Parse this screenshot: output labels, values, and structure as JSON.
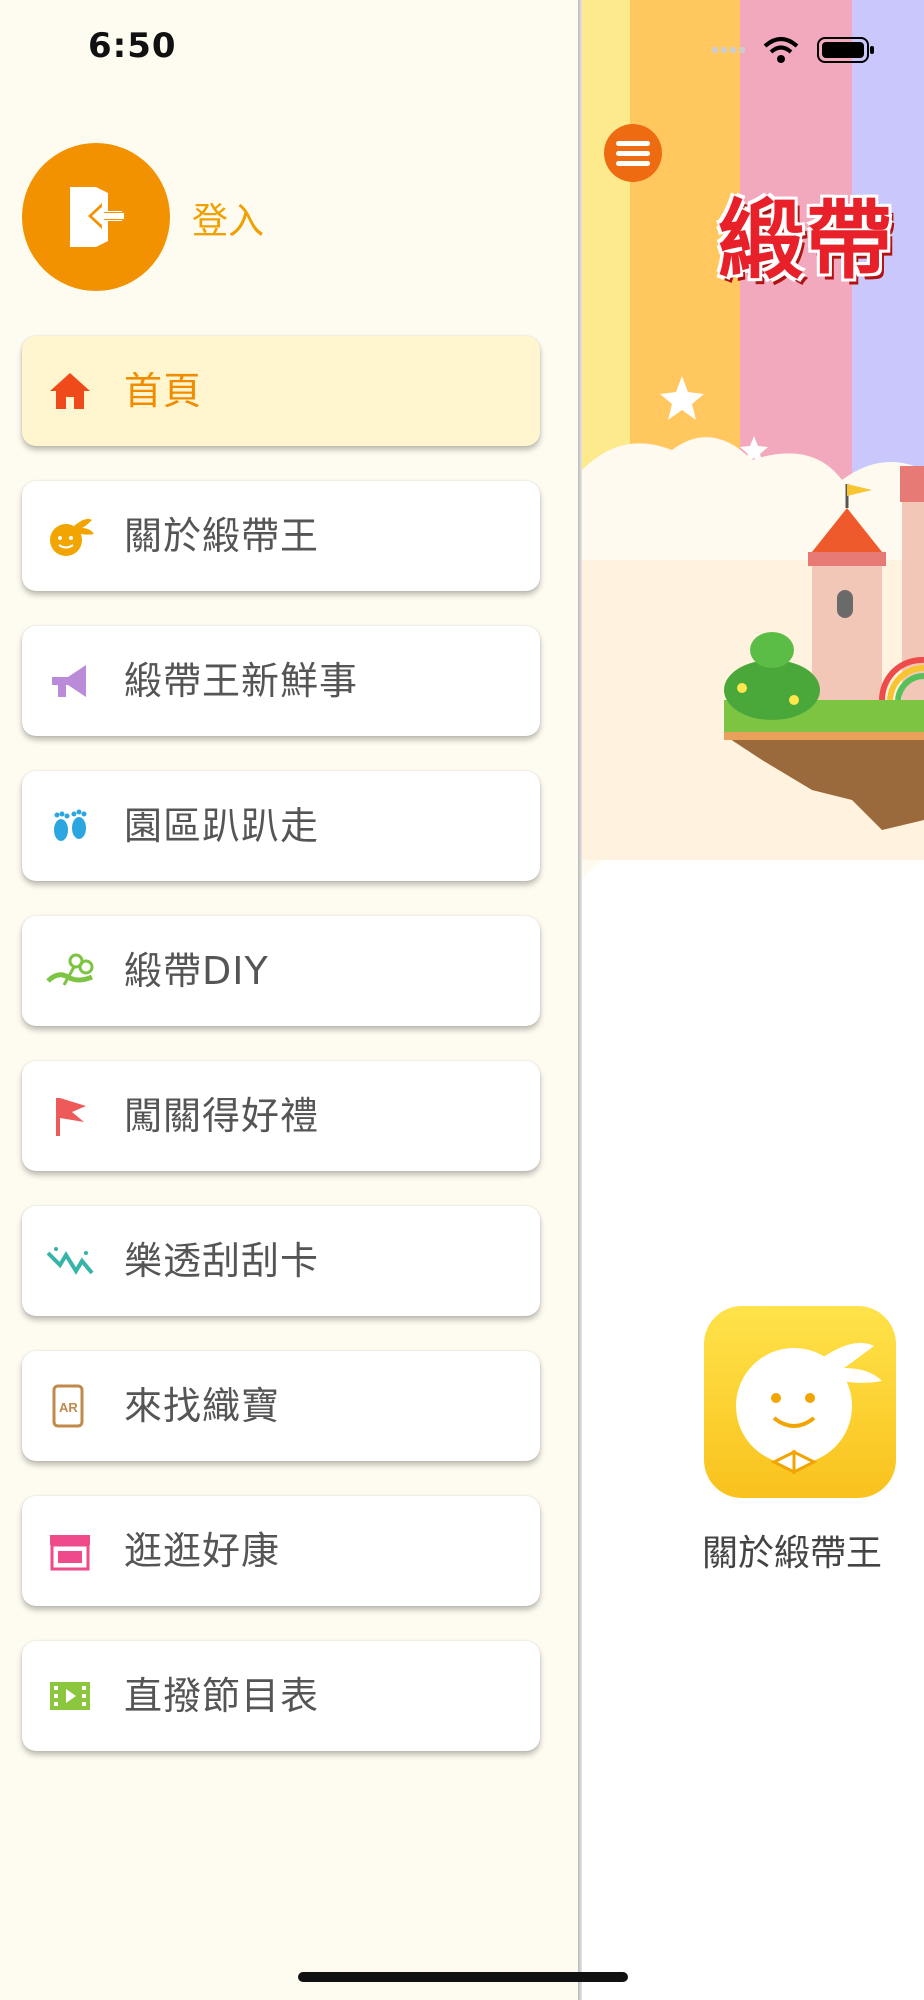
{
  "status_bar": {
    "time": "6:50"
  },
  "drawer": {
    "login_label": "登入",
    "menu": [
      {
        "label": "首頁",
        "icon": "home-icon",
        "active": true
      },
      {
        "label": "關於緞帶王",
        "icon": "mascot-icon",
        "active": false
      },
      {
        "label": "緞帶王新鮮事",
        "icon": "megaphone-icon",
        "active": false
      },
      {
        "label": "園區趴趴走",
        "icon": "footprints-icon",
        "active": false
      },
      {
        "label": "緞帶DIY",
        "icon": "ribbon-scissors-icon",
        "active": false
      },
      {
        "label": "闖關得好禮",
        "icon": "flag-icon",
        "active": false
      },
      {
        "label": "樂透刮刮卡",
        "icon": "scratch-card-icon",
        "active": false
      },
      {
        "label": "來找織寶",
        "icon": "ar-phone-icon",
        "active": false
      },
      {
        "label": "逛逛好康",
        "icon": "shop-icon",
        "active": false
      },
      {
        "label": "直撥節目表",
        "icon": "video-icon",
        "active": false
      }
    ]
  },
  "main": {
    "brand_title": "緞帶",
    "about_tile_label": "關於緞帶王"
  },
  "colors": {
    "accent_orange": "#f39200",
    "active_item_bg": "#fff6cf",
    "drawer_bg": "#fefcf1"
  }
}
